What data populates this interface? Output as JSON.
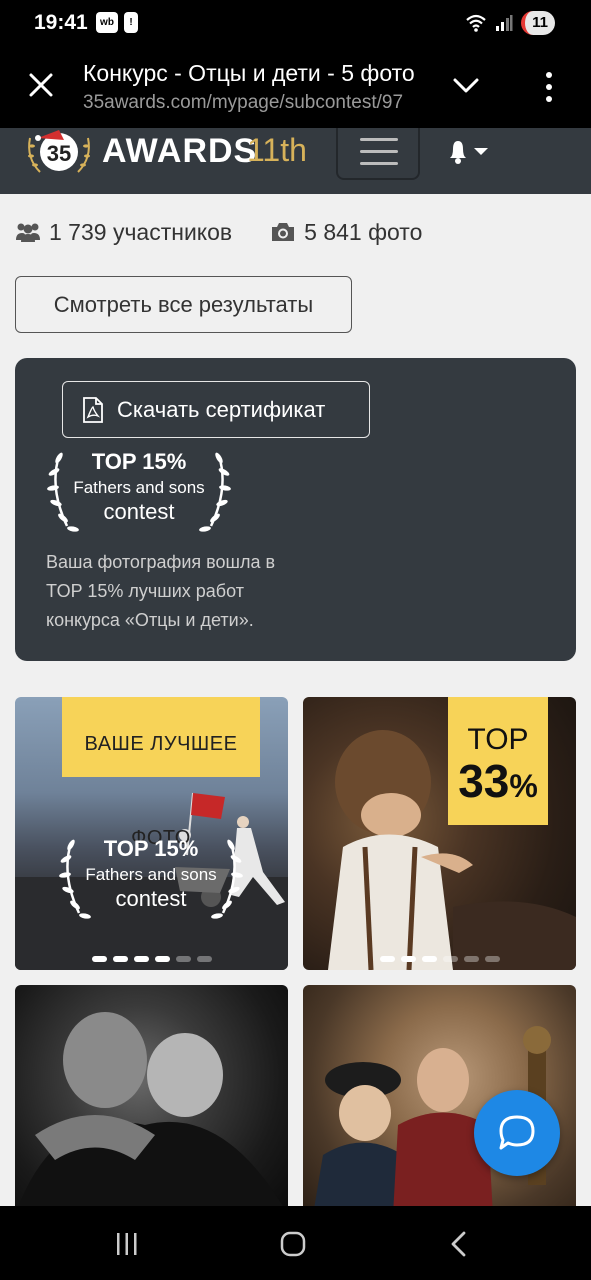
{
  "status_bar": {
    "time": "19:41",
    "app_icon_1": "wb",
    "app_icon_2": "!",
    "battery_level": "11"
  },
  "browser": {
    "title": "Конкурс - Отцы и дети - 5 фото",
    "url": "35awards.com/mypage/subcontest/97"
  },
  "header": {
    "logo_mark": "35",
    "logo_text": "AWARDS",
    "edition": "11th"
  },
  "stats": {
    "participants": "1 739 участников",
    "photos": "5 841 фото"
  },
  "results_button": "Смотреть все результаты",
  "certificate": {
    "button": "Скачать сертификат",
    "badge_top": "TOP 15%",
    "badge_middle": "Fathers and sons",
    "badge_bottom": "contest",
    "description": "Ваша фотография вошла в TOP 15% лучших работ конкурса «Отцы и дети»."
  },
  "photos": [
    {
      "label": "ВАШЕ ЛУЧШЕЕ ФОТО",
      "badge_top": "TOP 15%",
      "badge_middle": "Fathers and sons",
      "badge_bottom": "contest",
      "dots_total": 6,
      "dots_active": 4
    },
    {
      "label_top": "TOP",
      "label_value": "33",
      "label_unit": "%",
      "dots_total": 6,
      "dots_active": 3
    },
    {},
    {}
  ],
  "colors": {
    "header_bg": "#343a40",
    "accent_yellow": "#f7d358",
    "fab_blue": "#1e88e5",
    "edition_gold": "#d7b25a"
  },
  "icons": [
    "close-icon",
    "chevron-down-icon",
    "kebab-menu-icon",
    "hamburger-icon",
    "bell-icon",
    "users-icon",
    "camera-icon",
    "pdf-icon",
    "laurel-icon",
    "chat-icon",
    "recents-icon",
    "home-icon",
    "back-icon"
  ]
}
